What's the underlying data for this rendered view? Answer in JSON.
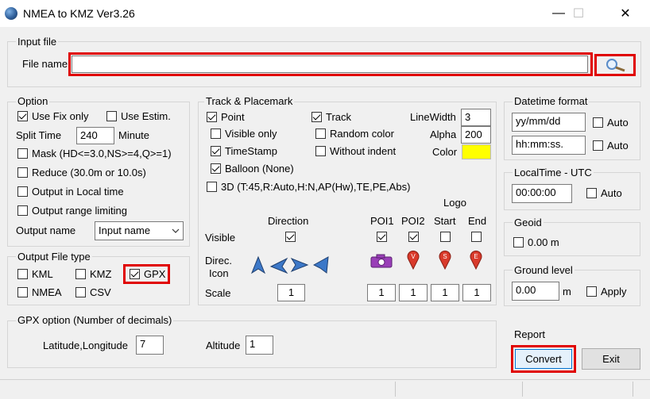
{
  "window": {
    "title": "NMEA to KMZ  Ver3.26",
    "minimize": "—",
    "maximize": "☐",
    "close": "✕"
  },
  "input_file": {
    "group_label": "Input file",
    "file_label": "File name",
    "file_value": ""
  },
  "option": {
    "group_label": "Option",
    "use_fix_only": {
      "label": "Use Fix only",
      "checked": true
    },
    "use_estim": {
      "label": "Use Estim.",
      "checked": false
    },
    "split_time_label": "Split Time",
    "split_time_value": "240",
    "split_time_unit": "Minute",
    "mask": {
      "label": "Mask (HD<=3.0,NS>=4,Q>=1)",
      "checked": false
    },
    "reduce": {
      "label": "Reduce (30.0m or 10.0s)",
      "checked": false
    },
    "output_local_time": {
      "label": "Output in Local time",
      "checked": false
    },
    "output_range": {
      "label": "Output range limiting",
      "checked": false
    },
    "output_name_label": "Output name",
    "output_name_value": "Input name"
  },
  "output_file_type": {
    "group_label": "Output File type",
    "kml": {
      "label": "KML",
      "checked": false
    },
    "kmz": {
      "label": "KMZ",
      "checked": false
    },
    "gpx": {
      "label": "GPX",
      "checked": true
    },
    "nmea": {
      "label": "NMEA",
      "checked": false
    },
    "csv": {
      "label": "CSV",
      "checked": false
    }
  },
  "track_placemark": {
    "group_label": "Track & Placemark",
    "point": {
      "label": "Point",
      "checked": true
    },
    "track": {
      "label": "Track",
      "checked": true
    },
    "visible_only": {
      "label": "Visible only",
      "checked": false
    },
    "random_color": {
      "label": "Random color",
      "checked": false
    },
    "timestamp": {
      "label": "TimeStamp",
      "checked": true
    },
    "without_indent": {
      "label": "Without indent",
      "checked": false
    },
    "balloon": {
      "label": "Balloon (None)",
      "checked": true
    },
    "three_d": {
      "label": "3D (T:45,R:Auto,H:N,AP(Hw),TE,PE,Abs)",
      "checked": false
    },
    "linewidth_label": "LineWidth",
    "linewidth_value": "3",
    "alpha_label": "Alpha",
    "alpha_value": "200",
    "color_label": "Color",
    "color_value": "#ffff00",
    "logo_label": "Logo",
    "direction_label": "Direction",
    "poi1_label": "POI1",
    "poi2_label": "POI2",
    "start_label": "Start",
    "end_label": "End",
    "visible_label": "Visible",
    "direc_icon_label_1": "Direc.",
    "direc_icon_label_2": "Icon",
    "scale_label": "Scale",
    "direction_visible": true,
    "poi1_visible": true,
    "poi2_visible": true,
    "start_visible": false,
    "end_visible": false,
    "direction_scale": "1",
    "poi1_scale": "1",
    "poi2_scale": "1",
    "start_scale": "1",
    "end_scale": "1",
    "pin_letters": {
      "poi2": "V",
      "start": "S",
      "end": "E"
    }
  },
  "datetime_format": {
    "group_label": "Datetime format",
    "date_value": "yy/mm/dd",
    "date_auto": {
      "label": "Auto",
      "checked": false
    },
    "time_value": "hh:mm:ss.",
    "time_auto": {
      "label": "Auto",
      "checked": false
    }
  },
  "localtime_utc": {
    "group_label": "LocalTime - UTC",
    "value": "00:00:00",
    "auto": {
      "label": "Auto",
      "checked": false
    }
  },
  "geoid": {
    "group_label": "Geoid",
    "label": "0.00 m",
    "checked": false
  },
  "ground_level": {
    "group_label": "Ground level",
    "value": "0.00",
    "unit": "m",
    "apply": {
      "label": "Apply",
      "checked": false
    }
  },
  "gpx_option": {
    "group_label": "GPX option (Number of decimals)",
    "latlon_label": "Latitude,Longitude",
    "latlon_value": "7",
    "altitude_label": "Altitude",
    "altitude_value": "1"
  },
  "report_label": "Report",
  "convert_label": "Convert",
  "exit_label": "Exit",
  "colors": {
    "highlight": "#e00000",
    "accent_blue": "#3c78c8",
    "pin_red": "#d93a2b",
    "camera_purple": "#9a3fb8"
  }
}
